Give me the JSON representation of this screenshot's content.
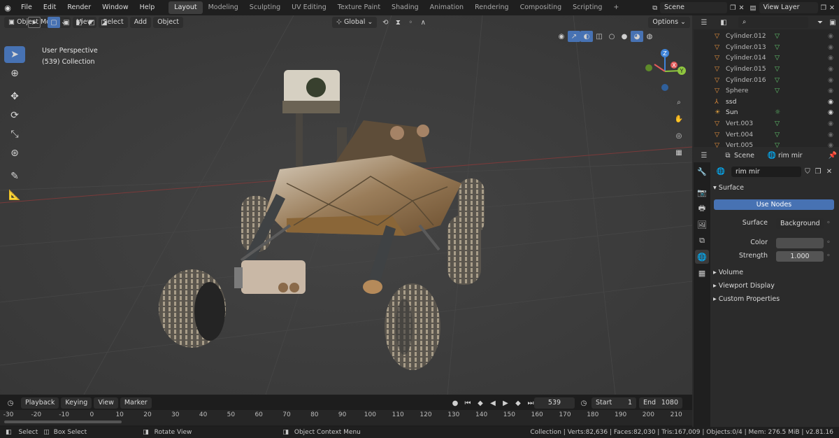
{
  "topbar": {
    "menus": [
      "File",
      "Edit",
      "Render",
      "Window",
      "Help"
    ],
    "workspaces": [
      "Layout",
      "Modeling",
      "Sculpting",
      "UV Editing",
      "Texture Paint",
      "Shading",
      "Animation",
      "Rendering",
      "Compositing",
      "Scripting"
    ],
    "active_workspace": "Layout",
    "add_tab": "+",
    "scene": "Scene",
    "view_layer": "View Layer"
  },
  "viewport": {
    "mode": "Object Mode",
    "menus": [
      "View",
      "Select",
      "Add",
      "Object"
    ],
    "orientation": "Global",
    "options": "Options",
    "overlay_line1": "User Perspective",
    "overlay_line2": "(539) Collection",
    "gizmo": {
      "x": "X",
      "y": "Y",
      "z": "Z"
    }
  },
  "outliner": {
    "rows": [
      {
        "name": "Cylinder.012",
        "type": "mesh"
      },
      {
        "name": "Cylinder.013",
        "type": "mesh"
      },
      {
        "name": "Cylinder.014",
        "type": "mesh"
      },
      {
        "name": "Cylinder.015",
        "type": "mesh"
      },
      {
        "name": "Cylinder.016",
        "type": "mesh"
      },
      {
        "name": "Sphere",
        "type": "mesh"
      },
      {
        "name": "ssd",
        "type": "empty"
      },
      {
        "name": "Sun",
        "type": "light"
      },
      {
        "name": "Vert.003",
        "type": "mesh"
      },
      {
        "name": "Vert.004",
        "type": "mesh"
      },
      {
        "name": "Vert.005",
        "type": "mesh"
      }
    ]
  },
  "properties": {
    "breadcrumb_scene": "Scene",
    "breadcrumb_world": "rim mir",
    "world_name": "rim mir",
    "surface_header": "Surface",
    "use_nodes": "Use Nodes",
    "surface_label": "Surface",
    "surface_value": "Background",
    "color_label": "Color",
    "strength_label": "Strength",
    "strength_value": "1.000",
    "volume_header": "Volume",
    "viewport_display_header": "Viewport Display",
    "custom_props_header": "Custom Properties"
  },
  "timeline": {
    "menus": [
      "Playback",
      "Keying",
      "View",
      "Marker"
    ],
    "current_frame": "539",
    "start_label": "Start",
    "start_value": "1",
    "end_label": "End",
    "end_value": "1080",
    "ruler": [
      "-30",
      "-20",
      "-10",
      "0",
      "10",
      "20",
      "30",
      "40",
      "50",
      "60",
      "70",
      "80",
      "90",
      "100",
      "110",
      "120",
      "130",
      "140",
      "150",
      "160",
      "170",
      "180",
      "190",
      "200",
      "210"
    ]
  },
  "statusbar": {
    "select": "Select",
    "box_select": "Box Select",
    "rotate_view": "Rotate View",
    "context_menu": "Object Context Menu",
    "stats": "Collection | Verts:82,636 | Faces:82,030 | Tris:167,009 | Objects:0/4 | Mem: 276.5 MiB | v2.81.16"
  },
  "colors": {
    "accent": "#4772b3",
    "x_axis": "#e35b5b",
    "y_axis": "#8fc63f",
    "z_axis": "#3f84d9"
  }
}
